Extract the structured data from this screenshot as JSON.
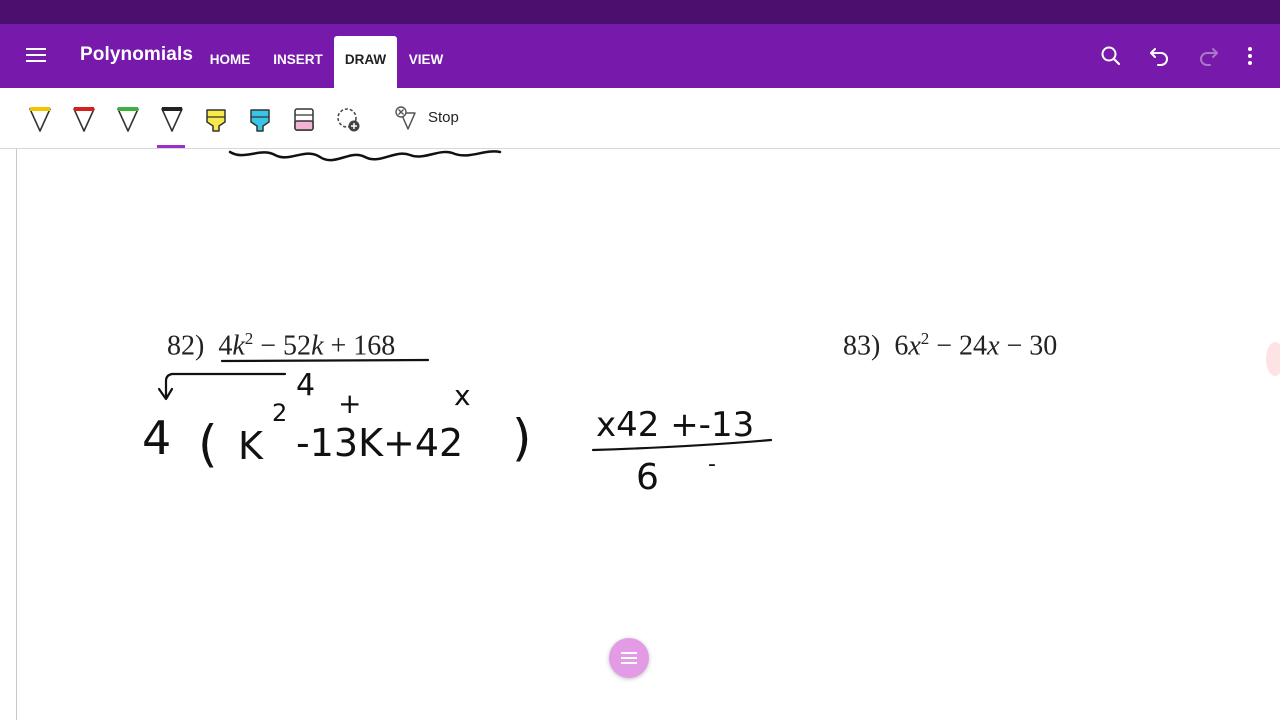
{
  "app": {
    "title": "Polynomials",
    "tabs": [
      {
        "label": "HOME",
        "active": false
      },
      {
        "label": "INSERT",
        "active": false
      },
      {
        "label": "DRAW",
        "active": true
      },
      {
        "label": "VIEW",
        "active": false
      }
    ],
    "icons": [
      "menu-icon",
      "search-icon",
      "undo-icon",
      "redo-icon",
      "more-icon"
    ]
  },
  "ribbon": {
    "tools": [
      {
        "name": "yellow-pen",
        "color": "#f2c500"
      },
      {
        "name": "red-pen",
        "color": "#d42020"
      },
      {
        "name": "green-pen",
        "color": "#3db13d"
      },
      {
        "name": "black-pen",
        "color": "#222222",
        "selected": true
      },
      {
        "name": "yellow-highlighter",
        "color": "#f7e94a"
      },
      {
        "name": "cyan-highlighter",
        "color": "#39c6e6"
      },
      {
        "name": "pink-highlighter",
        "color": "#f2b3d4"
      },
      {
        "name": "lasso-select",
        "color": "#444444"
      }
    ],
    "stop_label": "Stop"
  },
  "colors": {
    "status_bar": "#4b0f6d",
    "app_bar": "#7719aa",
    "accent": "#9b30c8",
    "fab": "#e49be6"
  },
  "problems": [
    {
      "number": "82)",
      "coef1": "4",
      "var1": "k",
      "exp": "2",
      "rest": "− 52",
      "var2": "k",
      "tail": "+ 168"
    },
    {
      "number": "83)",
      "coef1": "6",
      "var1": "x",
      "exp": "2",
      "rest": "− 24",
      "var2": "x",
      "tail": "− 30"
    }
  ],
  "handwriting": {
    "gcf": "4",
    "plus_mark": "+",
    "times_mark": "x",
    "factor_leading": "4",
    "factor_open": "(",
    "factor_var": "K",
    "factor_exp": "2",
    "factor_mid": "-13K+42",
    "factor_close": ")",
    "diamond_top": "x42 +-13",
    "diamond_bottom": "6",
    "diamond_dash": "-"
  }
}
